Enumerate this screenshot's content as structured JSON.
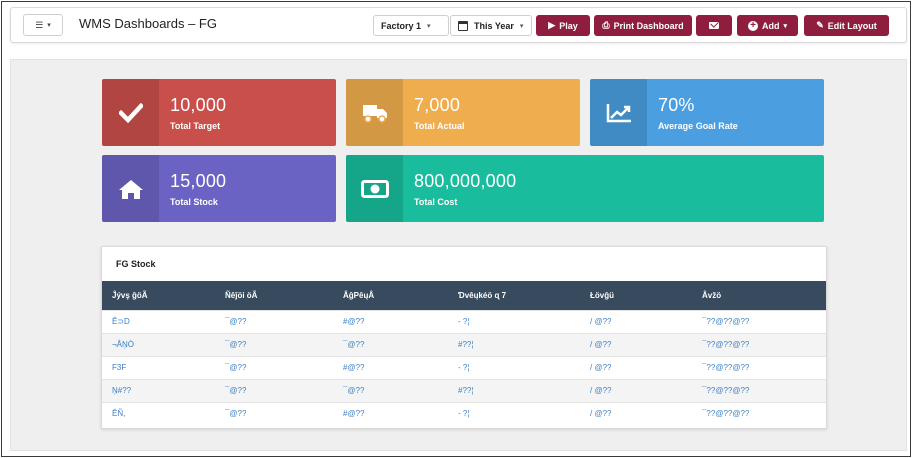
{
  "header": {
    "menu_label": "☰",
    "title": "WMS Dashboards – FG",
    "factory_select": "Factory 1",
    "period_select": "This Year",
    "buttons": {
      "play": "Play",
      "print": "Print Dashboard",
      "add": "Add",
      "edit": "Edit Layout"
    }
  },
  "cards": [
    {
      "value": "10,000",
      "label": "Total Target",
      "icon": "check-icon",
      "color": "#c94f4b"
    },
    {
      "value": "7,000",
      "label": "Total Actual",
      "icon": "truck-icon",
      "color": "#f0ad4e"
    },
    {
      "value": "70%",
      "label": "Average Goal Rate",
      "icon": "trend-chart-icon",
      "color": "#4b9fe1"
    },
    {
      "value": "15,000",
      "label": "Total Stock",
      "icon": "home-icon",
      "color": "#6b63c4"
    },
    {
      "value": "800,000,000",
      "label": "Total Cost",
      "icon": "money-icon",
      "color": "#19bc9c"
    }
  ],
  "stock_table": {
    "title": "FG Stock",
    "columns": [
      "Ĵývş ĝöÃ",
      "Ñêĵöi öÃ",
      "ÂĝPêųÂ",
      "Ɗvêųkéö ɋ 7",
      "Łövĝü",
      "Âvžö"
    ],
    "rows": [
      [
        "Ê⊃D",
        "¯@??",
        "#@??",
        "- ?¦",
        "/ @??",
        "¯??@??@??"
      ],
      [
        "¬ÂŅÒ",
        "¯@??",
        "¯@??",
        "#??¦",
        "/ @??",
        "¯??@??@??"
      ],
      [
        "F3F",
        "¯@??",
        "#@??",
        "- ?¦",
        "/ @??",
        "¯??@??@??"
      ],
      [
        "Ņ#??",
        "¯@??",
        "¯@??",
        "#??¦",
        "/ @??",
        "¯??@??@??"
      ],
      [
        "ÊÑ,",
        "¯@??",
        "#@??",
        "- ?¦",
        "/ @??",
        "¯??@??@??"
      ]
    ]
  }
}
